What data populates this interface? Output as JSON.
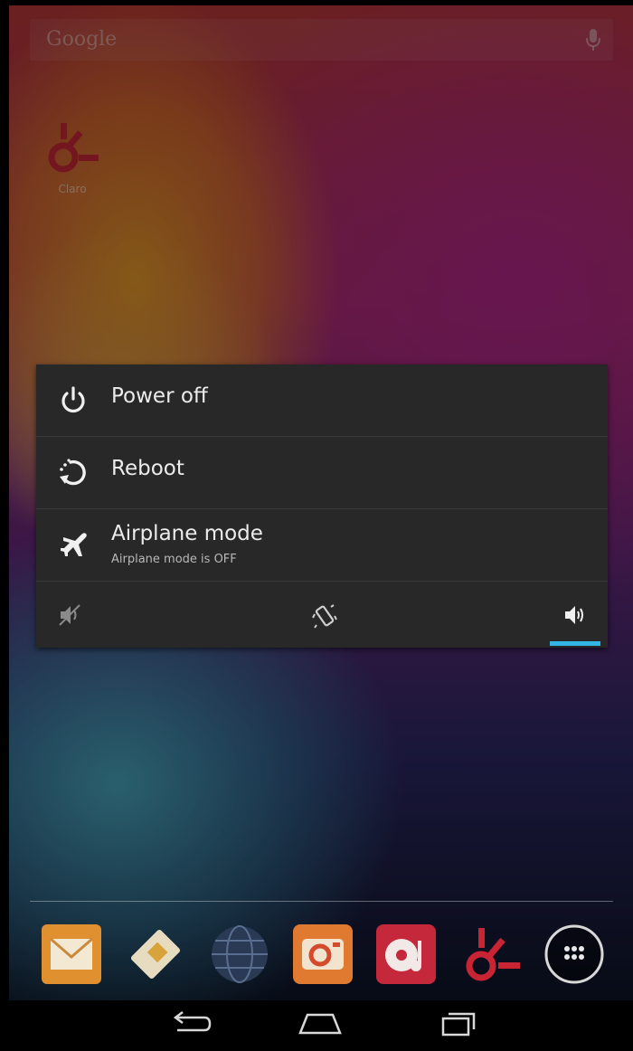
{
  "search": {
    "logo_text": "Google"
  },
  "home_app": {
    "label": "Claro"
  },
  "power_menu": {
    "items": [
      {
        "label": "Power off"
      },
      {
        "label": "Reboot"
      },
      {
        "label": "Airplane mode",
        "sublabel": "Airplane mode is OFF"
      }
    ],
    "sound_modes": [
      "silent",
      "vibrate",
      "sound"
    ],
    "selected_sound_mode": "sound"
  },
  "dock_apps": [
    "email-icon",
    "sim-toolkit-icon",
    "browser-globe-icon",
    "camera-icon",
    "music-icon",
    "claro-icon",
    "all-apps-icon"
  ],
  "colors": {
    "accent": "#33b5e5",
    "dialog_bg": "#282828"
  }
}
